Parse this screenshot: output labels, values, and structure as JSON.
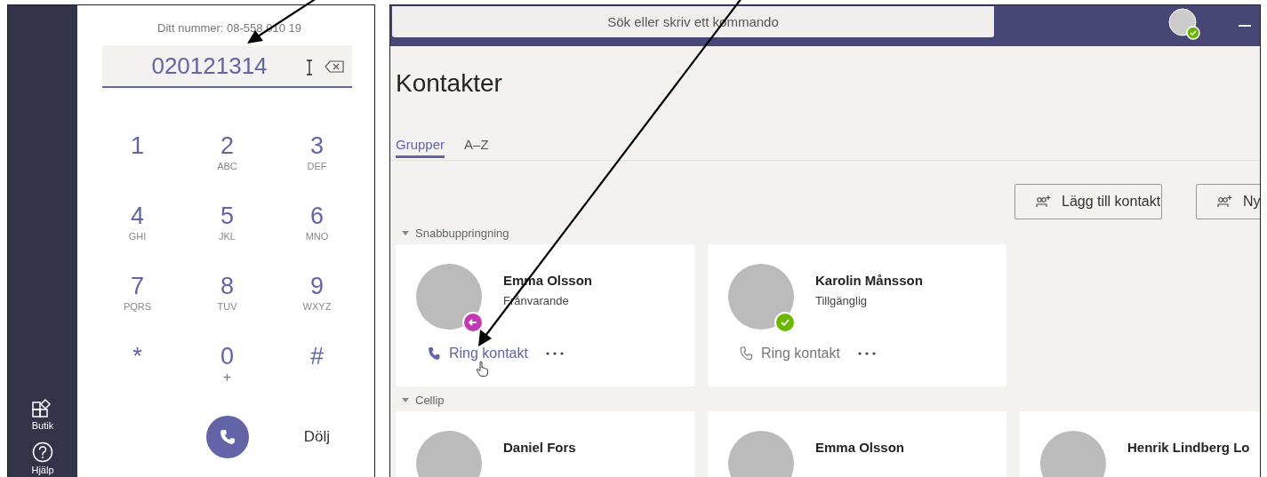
{
  "sidebar": {
    "items": [
      {
        "label": "Butik",
        "kind": "store"
      },
      {
        "label": "Hjälp",
        "kind": "help"
      }
    ]
  },
  "dialpad": {
    "own_number": "Ditt nummer: 08-558 010 19",
    "value": "020121314",
    "keys": [
      {
        "digit": "1"
      },
      {
        "digit": "2",
        "letters": "ABC"
      },
      {
        "digit": "3",
        "letters": "DEF"
      },
      {
        "digit": "4",
        "letters": "GHI"
      },
      {
        "digit": "5",
        "letters": "JKL"
      },
      {
        "digit": "6",
        "letters": "MNO"
      },
      {
        "digit": "7",
        "letters": "PQRS"
      },
      {
        "digit": "8",
        "letters": "TUV"
      },
      {
        "digit": "9",
        "letters": "WXYZ"
      },
      {
        "digit": "*"
      },
      {
        "digit": "0",
        "letters": "+"
      },
      {
        "digit": "#"
      }
    ],
    "hide_label": "Dölj"
  },
  "header": {
    "search_placeholder": "Sök eller skriv ett kommando"
  },
  "page": {
    "title": "Kontakter",
    "tabs": [
      {
        "label": "Grupper",
        "selected": true
      },
      {
        "label": "A–Z",
        "selected": false
      }
    ],
    "actions": [
      "Lägg till kontakt",
      "Ny"
    ]
  },
  "groups": [
    {
      "name": "Snabbuppringning",
      "expanded": true,
      "contacts": [
        {
          "name": "Emma Olsson",
          "status": "Frånvarande",
          "kind": "away",
          "color": "#c239b3",
          "call_label": "Ring kontakt",
          "hovered": true
        },
        {
          "name": "Karolin Månsson",
          "status": "Tillgänglig",
          "kind": "available",
          "color": "#6bb700",
          "call_label": "Ring kontakt",
          "hovered": false
        }
      ]
    },
    {
      "name": "Cellip",
      "expanded": true,
      "contacts": [
        {
          "name": "Daniel Fors"
        },
        {
          "name": "Emma Olsson"
        },
        {
          "name": "Henrik Lindberg Lo"
        }
      ]
    }
  ]
}
